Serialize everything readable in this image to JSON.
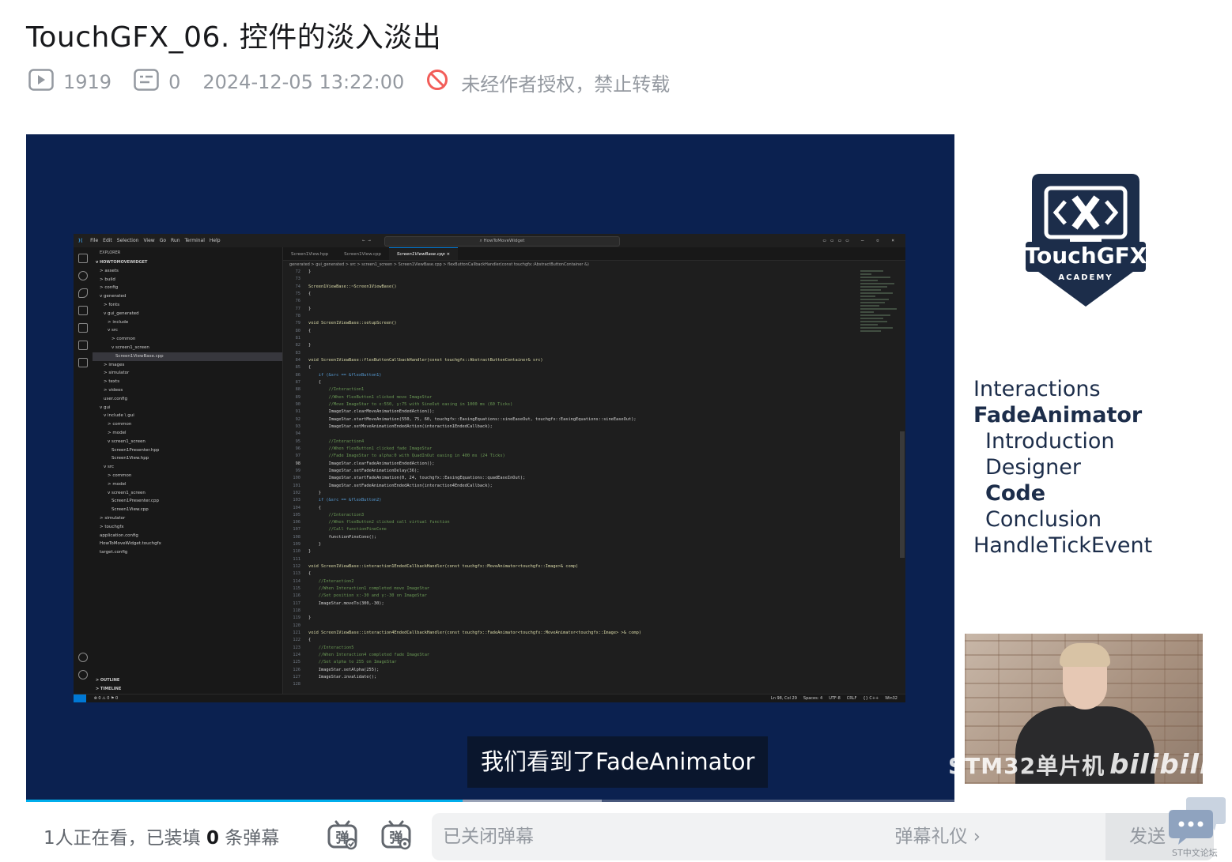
{
  "video": {
    "title": "TouchGFX_06. 控件的淡入淡出",
    "play_count": "1919",
    "comment_count": "0",
    "publish_time": "2024-12-05 13:22:00",
    "copyright_notice": "未经作者授权，禁止转载"
  },
  "player": {
    "subtitle": "我们看到了FadeAnimator",
    "watermark_channel": "STM32单片机",
    "watermark_brand": "bilibili",
    "progress_played_fraction": 0.47,
    "progress_buffered_fraction": 0.62
  },
  "slide": {
    "logo_title": "TouchGFX",
    "logo_subtitle": "ACADEMY",
    "topics": [
      {
        "label": "Interactions",
        "bold": false,
        "indent": false
      },
      {
        "label": "FadeAnimator",
        "bold": true,
        "indent": false
      },
      {
        "label": "Introduction",
        "bold": false,
        "indent": true
      },
      {
        "label": "Designer",
        "bold": false,
        "indent": true
      },
      {
        "label": "Code",
        "bold": true,
        "indent": true
      },
      {
        "label": "Conclusion",
        "bold": false,
        "indent": true
      },
      {
        "label": "HandleTickEvent",
        "bold": false,
        "indent": false
      }
    ]
  },
  "vscode": {
    "menu": [
      "File",
      "Edit",
      "Selection",
      "View",
      "Go",
      "Run",
      "Terminal",
      "Help"
    ],
    "search": "HowToMoveWidget",
    "explorer_header": "EXPLORER",
    "project": "HOWTOMOVEWIDGET",
    "tree": [
      {
        "label": "> assets",
        "depth": 1
      },
      {
        "label": "> build",
        "depth": 1
      },
      {
        "label": "> config",
        "depth": 1
      },
      {
        "label": "v generated",
        "depth": 1
      },
      {
        "label": "> fonts",
        "depth": 2
      },
      {
        "label": "v gui_generated",
        "depth": 2
      },
      {
        "label": "> include",
        "depth": 3
      },
      {
        "label": "v src",
        "depth": 3
      },
      {
        "label": "> common",
        "depth": 4
      },
      {
        "label": "v screen1_screen",
        "depth": 4
      },
      {
        "label": "Screen1ViewBase.cpp",
        "depth": 5,
        "selected": true
      },
      {
        "label": "> images",
        "depth": 2
      },
      {
        "label": "> simulator",
        "depth": 2
      },
      {
        "label": "> texts",
        "depth": 2
      },
      {
        "label": "> videos",
        "depth": 2
      },
      {
        "label": "user.config",
        "depth": 2
      },
      {
        "label": "v gui",
        "depth": 1
      },
      {
        "label": "v include \\ gui",
        "depth": 2
      },
      {
        "label": "> common",
        "depth": 3
      },
      {
        "label": "> model",
        "depth": 3
      },
      {
        "label": "v screen1_screen",
        "depth": 3
      },
      {
        "label": "Screen1Presenter.hpp",
        "depth": 4
      },
      {
        "label": "Screen1View.hpp",
        "depth": 4
      },
      {
        "label": "v src",
        "depth": 2
      },
      {
        "label": "> common",
        "depth": 3
      },
      {
        "label": "> model",
        "depth": 3
      },
      {
        "label": "v screen1_screen",
        "depth": 3
      },
      {
        "label": "Screen1Presenter.cpp",
        "depth": 4
      },
      {
        "label": "Screen1View.cpp",
        "depth": 4
      },
      {
        "label": "> simulator",
        "depth": 1
      },
      {
        "label": "> touchgfx",
        "depth": 1
      },
      {
        "label": "application.config",
        "depth": 1
      },
      {
        "label": "HowToMoveWidget.touchgfx",
        "depth": 1
      },
      {
        "label": "target.config",
        "depth": 1
      }
    ],
    "outline": "> OUTLINE",
    "timeline": "> TIMELINE",
    "tabs": [
      {
        "label": "Screen1View.hpp",
        "active": false
      },
      {
        "label": "Screen1View.cpp",
        "active": false
      },
      {
        "label": "Screen1ViewBase.cpp ×",
        "active": true
      }
    ],
    "breadcrumb": "generated > gui_generated > src > screen1_screen > Screen1ViewBase.cpp > flexButtonCallbackHandler(const touchgfx::AbstractButtonContainer &)",
    "code": [
      {
        "n": "72",
        "t": "}",
        "c": "txt"
      },
      {
        "n": "73",
        "t": "",
        "c": "txt"
      },
      {
        "n": "74",
        "t": "Screen1ViewBase::~Screen1ViewBase()",
        "c": "fn"
      },
      {
        "n": "75",
        "t": "{",
        "c": "txt"
      },
      {
        "n": "76",
        "t": "",
        "c": "txt"
      },
      {
        "n": "77",
        "t": "}",
        "c": "txt"
      },
      {
        "n": "78",
        "t": "",
        "c": "txt"
      },
      {
        "n": "79",
        "t": "void Screen1ViewBase::setupScreen()",
        "c": "fn"
      },
      {
        "n": "80",
        "t": "{",
        "c": "txt"
      },
      {
        "n": "81",
        "t": "",
        "c": "txt"
      },
      {
        "n": "82",
        "t": "}",
        "c": "txt"
      },
      {
        "n": "83",
        "t": "",
        "c": "txt"
      },
      {
        "n": "84",
        "t": "void Screen1ViewBase::flexButtonCallbackHandler(const touchgfx::AbstractButtonContainer& src)",
        "c": "fn"
      },
      {
        "n": "85",
        "t": "{",
        "c": "txt"
      },
      {
        "n": "86",
        "t": "    if (&src == &flexButton1)",
        "c": "kw"
      },
      {
        "n": "87",
        "t": "    {",
        "c": "txt"
      },
      {
        "n": "88",
        "t": "        //Interaction1",
        "c": "cm"
      },
      {
        "n": "89",
        "t": "        //When flexButton1 clicked move ImageStar",
        "c": "cm"
      },
      {
        "n": "90",
        "t": "        //Move ImageStar to x:550, y:75 with SineOut easing in 1000 ms (60 Ticks)",
        "c": "cm"
      },
      {
        "n": "91",
        "t": "        ImageStar.clearMoveAnimationEndedAction();",
        "c": "txt"
      },
      {
        "n": "92",
        "t": "        ImageStar.startMoveAnimation(550, 75, 60, touchgfx::EasingEquations::sineEaseOut, touchgfx::EasingEquations::sineEaseOut);",
        "c": "txt"
      },
      {
        "n": "93",
        "t": "        ImageStar.setMoveAnimationEndedAction(interaction1EndedCallback);",
        "c": "txt"
      },
      {
        "n": "94",
        "t": "",
        "c": "txt"
      },
      {
        "n": "95",
        "t": "        //Interaction4",
        "c": "cm"
      },
      {
        "n": "96",
        "t": "        //When flexButton1 clicked fade ImageStar",
        "c": "cm"
      },
      {
        "n": "97",
        "t": "        //Fade ImageStar to alpha:0 with QuadInOut easing in 400 ms (24 Ticks)",
        "c": "cm"
      },
      {
        "n": "98",
        "t": "        ImageStar.clearFadeAnimationEndedAction();",
        "c": "txt",
        "cur": true
      },
      {
        "n": "99",
        "t": "        ImageStar.setFadeAnimationDelay(36);",
        "c": "txt"
      },
      {
        "n": "100",
        "t": "        ImageStar.startFadeAnimation(0, 24, touchgfx::EasingEquations::quadEaseInOut);",
        "c": "txt"
      },
      {
        "n": "101",
        "t": "        ImageStar.setFadeAnimationEndedAction(interaction4EndedCallback);",
        "c": "txt"
      },
      {
        "n": "102",
        "t": "    }",
        "c": "txt"
      },
      {
        "n": "103",
        "t": "    if (&src == &flexButton2)",
        "c": "kw"
      },
      {
        "n": "104",
        "t": "    {",
        "c": "txt"
      },
      {
        "n": "105",
        "t": "        //Interaction3",
        "c": "cm"
      },
      {
        "n": "106",
        "t": "        //When flexButton2 clicked call virtual function",
        "c": "cm"
      },
      {
        "n": "107",
        "t": "        //Call functionPineCone",
        "c": "cm"
      },
      {
        "n": "108",
        "t": "        functionPineCone();",
        "c": "txt"
      },
      {
        "n": "109",
        "t": "    }",
        "c": "txt"
      },
      {
        "n": "110",
        "t": "}",
        "c": "txt"
      },
      {
        "n": "111",
        "t": "",
        "c": "txt"
      },
      {
        "n": "112",
        "t": "void Screen1ViewBase::interaction1EndedCallbackHandler(const touchgfx::MoveAnimator<touchgfx::Image>& comp)",
        "c": "fn"
      },
      {
        "n": "113",
        "t": "{",
        "c": "txt"
      },
      {
        "n": "114",
        "t": "    //Interaction2",
        "c": "cm"
      },
      {
        "n": "115",
        "t": "    //When Interaction1 completed move ImageStar",
        "c": "cm"
      },
      {
        "n": "116",
        "t": "    //Set position x:-30 and y:-30 on ImageStar",
        "c": "cm"
      },
      {
        "n": "117",
        "t": "    ImageStar.moveTo(300,-30);",
        "c": "txt"
      },
      {
        "n": "118",
        "t": "",
        "c": "txt"
      },
      {
        "n": "119",
        "t": "}",
        "c": "txt"
      },
      {
        "n": "120",
        "t": "",
        "c": "txt"
      },
      {
        "n": "121",
        "t": "void Screen1ViewBase::interaction4EndedCallbackHandler(const touchgfx::FadeAnimator<touchgfx::MoveAnimator<touchgfx::Image> >& comp)",
        "c": "fn"
      },
      {
        "n": "122",
        "t": "{",
        "c": "txt"
      },
      {
        "n": "123",
        "t": "    //Interaction5",
        "c": "cm"
      },
      {
        "n": "124",
        "t": "    //When Interaction4 completed fade ImageStar",
        "c": "cm"
      },
      {
        "n": "125",
        "t": "    //Set alpha to 255 on ImageStar",
        "c": "cm"
      },
      {
        "n": "126",
        "t": "    ImageStar.setAlpha(255);",
        "c": "txt"
      },
      {
        "n": "127",
        "t": "    ImageStar.invalidate();",
        "c": "txt"
      },
      {
        "n": "128",
        "t": "",
        "c": "txt"
      }
    ],
    "status_left": "⊗ 0 ⚠ 0    ⚑ 0",
    "status_right": [
      "Ln 98, Col 29",
      "Spaces: 4",
      "UTF-8",
      "CRLF",
      "{} C++",
      "Win32"
    ]
  },
  "bottom": {
    "viewers_prefix": "1人正在看，已装填",
    "danmaku_count": "0",
    "viewers_suffix": "条弹幕",
    "input_placeholder": "已关闭弹幕",
    "gift_label": "弹幕礼仪 ›",
    "send_label": "发送",
    "forum_badge": "ST中文论坛"
  },
  "colors": {
    "accent": "#00aeec",
    "player_bg": "#0e2552",
    "logo_navy": "#1c2d4a",
    "prohibit_red": "#f25d59"
  }
}
